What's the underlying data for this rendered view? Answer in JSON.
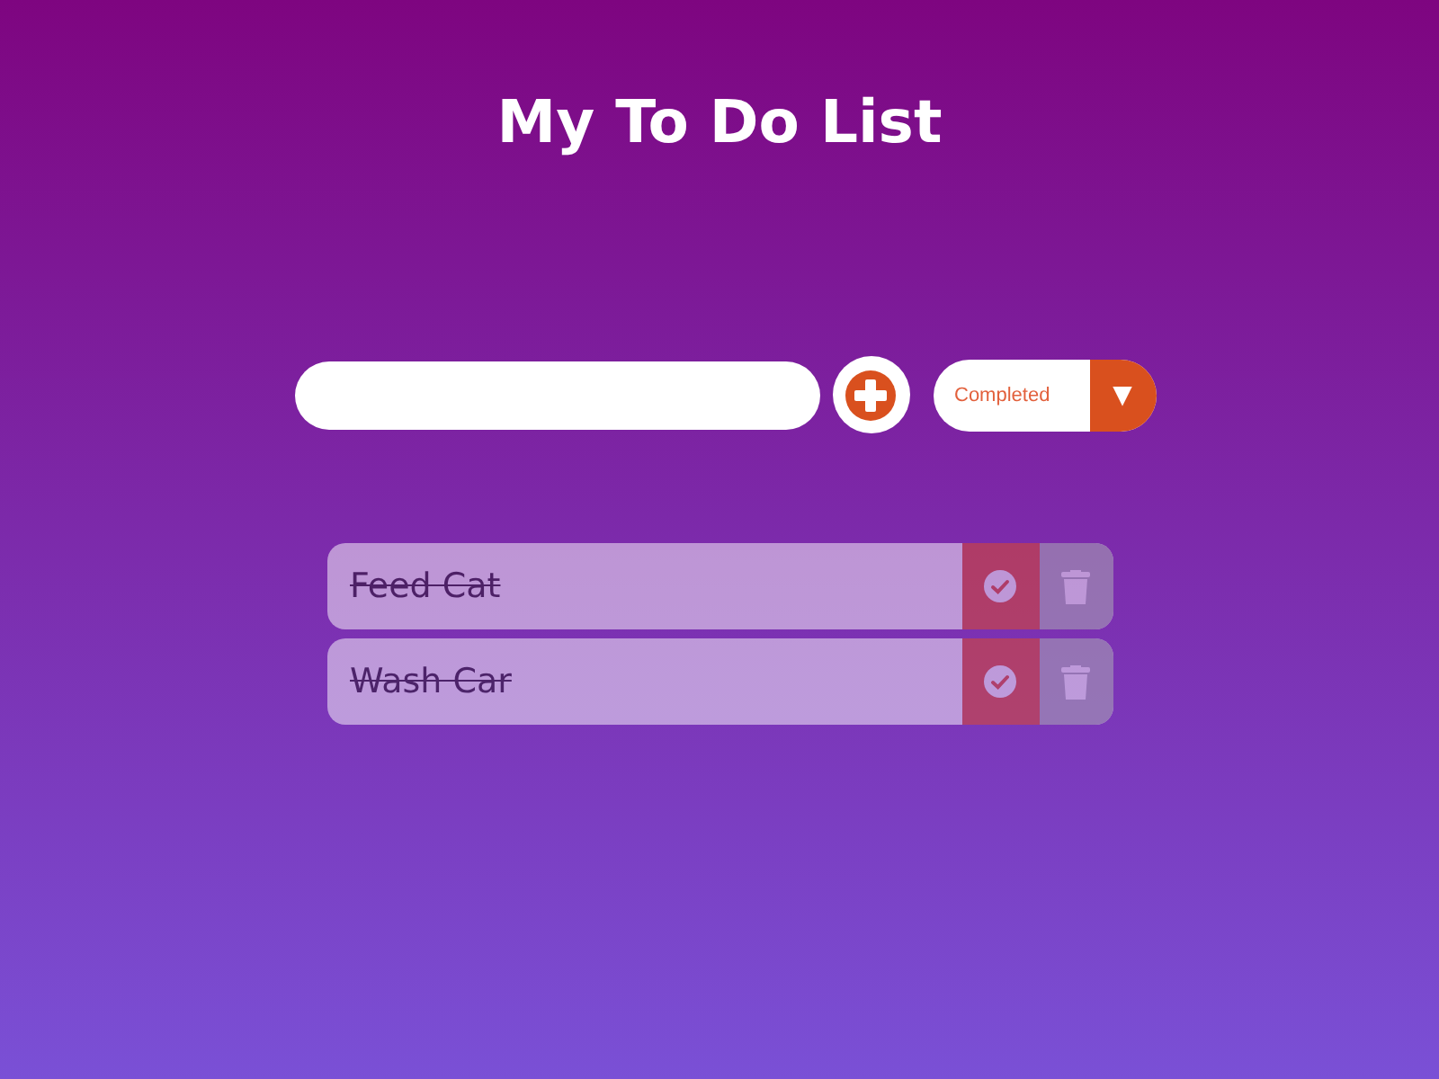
{
  "title": "My To Do List",
  "filter": {
    "value": "Completed",
    "arrow": "▼"
  },
  "todos": [
    {
      "text": "Feed Cat",
      "completed": true
    },
    {
      "text": "Wash Car",
      "completed": true
    }
  ]
}
